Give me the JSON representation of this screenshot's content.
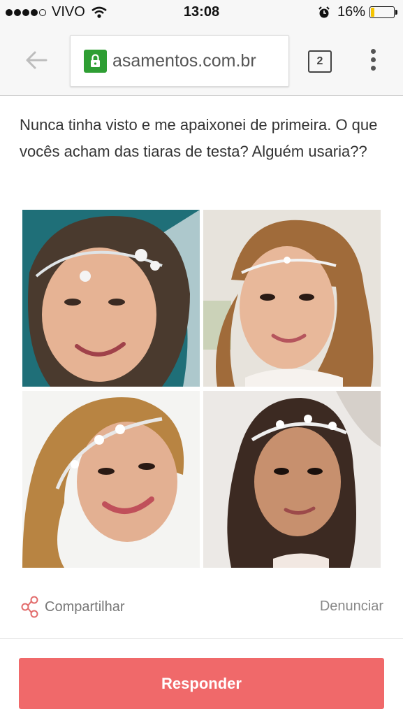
{
  "status_bar": {
    "carrier": "VIVO",
    "time": "13:08",
    "battery_percent": "16%",
    "battery_level": 0.16
  },
  "browser": {
    "url": "asamentos.com.br",
    "tab_count": "2"
  },
  "post": {
    "text": "Nunca tinha visto e me apaixonei de primeira. O que vocês acham das tiaras de testa? Alguém usaria??"
  },
  "actions": {
    "share_label": "Compartilhar",
    "report_label": "Denunciar",
    "reply_label": "Responder"
  },
  "colors": {
    "accent": "#f0696a",
    "lock_green": "#2e9e33",
    "battery_yellow": "#f5c400"
  },
  "icons": {
    "back": "arrow-left-icon",
    "lock": "lock-icon",
    "menu": "more-vertical-icon",
    "share": "share-icon",
    "wifi": "wifi-icon",
    "alarm": "alarm-icon"
  }
}
